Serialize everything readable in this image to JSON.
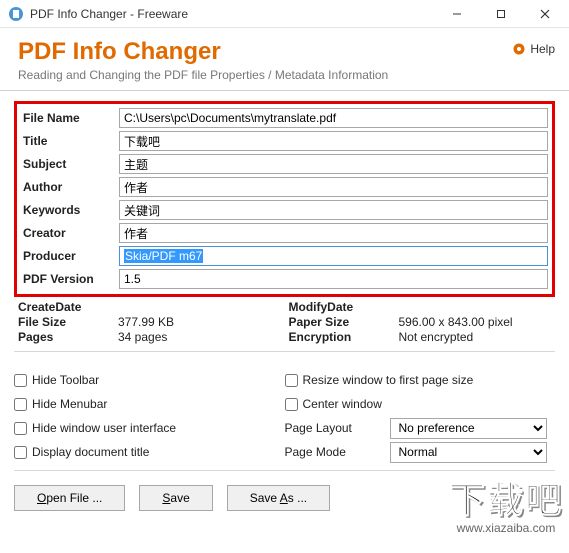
{
  "window": {
    "title": "PDF Info Changer - Freeware"
  },
  "header": {
    "app_title": "PDF Info Changer",
    "subtitle": "Reading and Changing the PDF file Properties / Metadata Information",
    "help": "Help"
  },
  "fields": {
    "file_name": {
      "label": "File Name",
      "value": "C:\\Users\\pc\\Documents\\mytranslate.pdf"
    },
    "title": {
      "label": "Title",
      "value": "下载吧"
    },
    "subject": {
      "label": "Subject",
      "value": "主题"
    },
    "author": {
      "label": "Author",
      "value": "作者"
    },
    "keywords": {
      "label": "Keywords",
      "value": "关键词"
    },
    "creator": {
      "label": "Creator",
      "value": "作者"
    },
    "producer": {
      "label": "Producer",
      "value": "Skia/PDF m67"
    },
    "pdf_version": {
      "label": "PDF Version",
      "value": "1.5"
    }
  },
  "readonly": {
    "create_date": {
      "label": "CreateDate",
      "value": ""
    },
    "modify_date": {
      "label": "ModifyDate",
      "value": ""
    },
    "file_size": {
      "label": "File Size",
      "value": "377.99 KB"
    },
    "paper_size": {
      "label": "Paper Size",
      "value": "596.00 x 843.00 pixel"
    },
    "pages": {
      "label": "Pages",
      "value": "34 pages"
    },
    "encryption": {
      "label": "Encryption",
      "value": "Not encrypted"
    }
  },
  "options": {
    "hide_toolbar": "Hide Toolbar",
    "hide_menubar": "Hide Menubar",
    "hide_window_ui": "Hide window user interface",
    "display_doc_title": "Display document title",
    "resize_window": "Resize window to first page size",
    "center_window": "Center window",
    "page_layout": {
      "label": "Page Layout",
      "value": "No preference"
    },
    "page_mode": {
      "label": "Page Mode",
      "value": "Normal"
    }
  },
  "buttons": {
    "open": {
      "u": "O",
      "rest": "pen File ..."
    },
    "save": {
      "u": "S",
      "rest": "ave"
    },
    "saveas": {
      "pre": "Save ",
      "u": "A",
      "rest": "s ..."
    }
  },
  "watermark": {
    "big": "下载吧",
    "url": "www.xiazaiba.com"
  }
}
